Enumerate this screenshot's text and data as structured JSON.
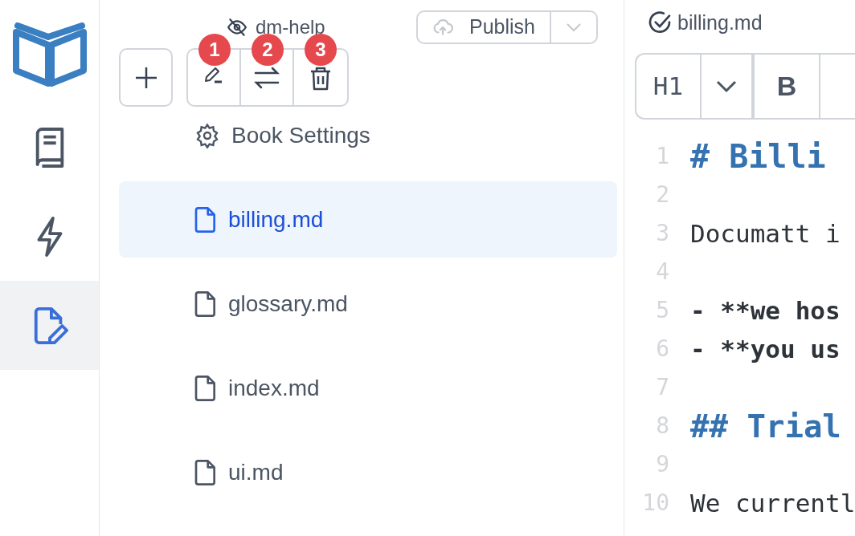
{
  "rail": [
    {
      "kind": "book",
      "selected": false
    },
    {
      "kind": "bolt",
      "selected": false
    },
    {
      "kind": "edit",
      "selected": true
    }
  ],
  "project": {
    "title": "dm-help",
    "publish": "Publish"
  },
  "toolbar": {
    "badges": [
      "1",
      "2",
      "3"
    ]
  },
  "tree": [
    {
      "kind": "settings",
      "label": "Book Settings",
      "selected": false
    },
    {
      "kind": "file",
      "label": "billing.md",
      "selected": true
    },
    {
      "kind": "file",
      "label": "glossary.md",
      "selected": false
    },
    {
      "kind": "file",
      "label": "index.md",
      "selected": false
    },
    {
      "kind": "file",
      "label": "ui.md",
      "selected": false
    }
  ],
  "editor": {
    "title": "billing.md",
    "heading_button": "H1",
    "bold_button": "B",
    "lines": [
      {
        "number": "1",
        "kind": "h1",
        "text": "# Billi"
      },
      {
        "number": "2",
        "kind": "blank"
      },
      {
        "number": "3",
        "kind": "text",
        "text": "Documatt i"
      },
      {
        "number": "4",
        "kind": "blank"
      },
      {
        "number": "5",
        "kind": "bold",
        "text": "- **we hos"
      },
      {
        "number": "6",
        "kind": "bold",
        "text": "- **you us"
      },
      {
        "number": "7",
        "kind": "blank"
      },
      {
        "number": "8",
        "kind": "h2",
        "text": "## Trial"
      },
      {
        "number": "9",
        "kind": "blank"
      },
      {
        "number": "10",
        "kind": "text",
        "text": "We currentl"
      }
    ]
  }
}
